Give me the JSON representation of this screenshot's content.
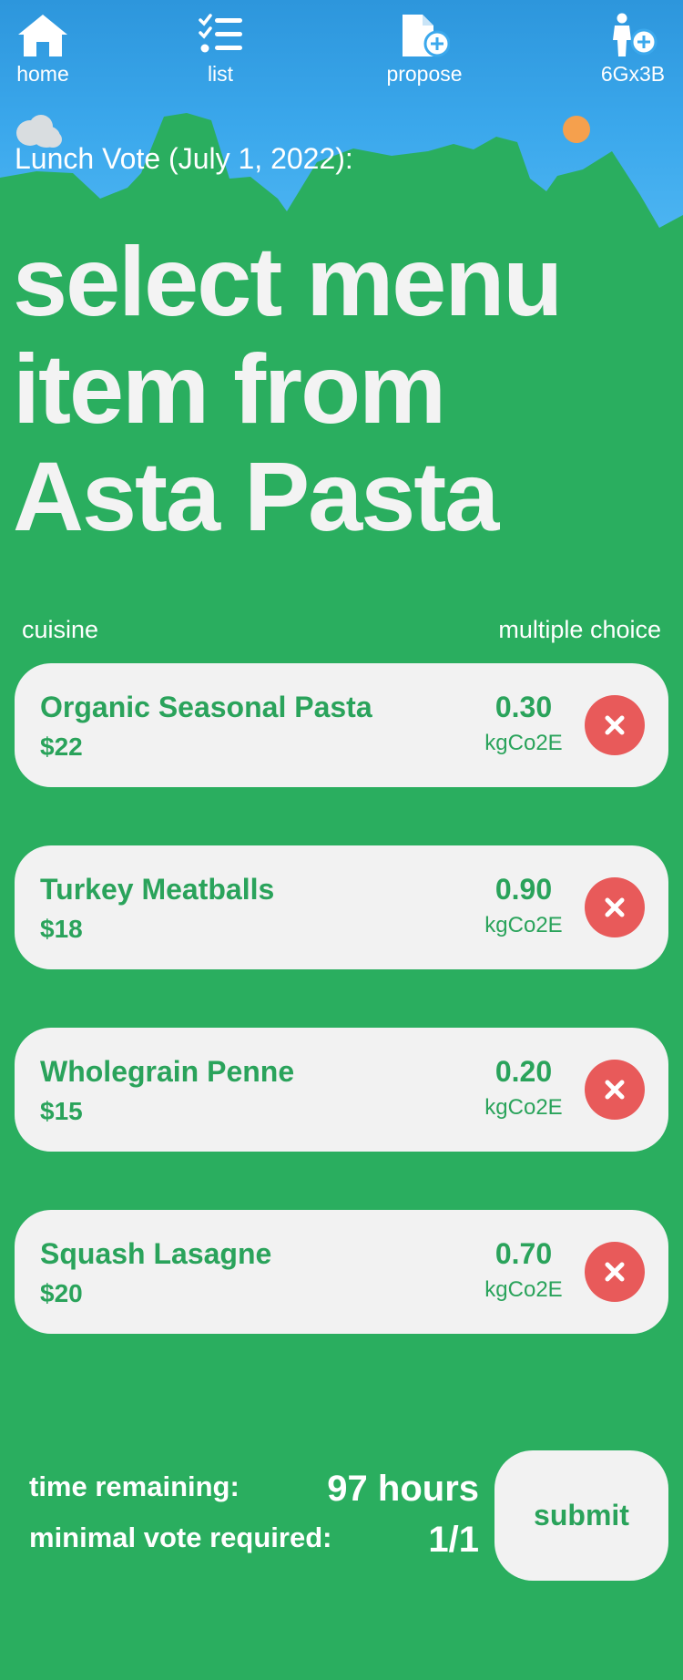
{
  "nav": {
    "home_label": "home",
    "list_label": "list",
    "propose_label": "propose",
    "user_label": "6Gx3B"
  },
  "vote_title": "Lunch Vote (July 1, 2022):",
  "headline": {
    "line1": "select menu",
    "line2": "item from",
    "line3": "Asta Pasta"
  },
  "list_header": {
    "left": "cuisine",
    "right": "multiple choice"
  },
  "menu_items": [
    {
      "name": "Organic Seasonal Pasta",
      "price": "$22",
      "co2": "0.30",
      "unit": "kgCo2E"
    },
    {
      "name": "Turkey Meatballs",
      "price": "$18",
      "co2": "0.90",
      "unit": "kgCo2E"
    },
    {
      "name": "Wholegrain Penne",
      "price": "$15",
      "co2": "0.20",
      "unit": "kgCo2E"
    },
    {
      "name": "Squash Lasagne",
      "price": "$20",
      "co2": "0.70",
      "unit": "kgCo2E"
    }
  ],
  "footer": {
    "time_label": "time remaining:",
    "time_value": "97 hours",
    "vote_label": "minimal vote required:",
    "vote_value": "1/1",
    "submit_label": "submit"
  },
  "icons": {
    "home": "home-icon",
    "list": "checklist-icon",
    "propose": "add-document-icon",
    "user": "add-person-icon",
    "remove": "close-icon"
  },
  "colors": {
    "background_green": "#2aae5f",
    "sky_blue": "#3ba8ec",
    "card_bg": "#f2f2f2",
    "text_green": "#2aa35b",
    "remove_red": "#e85a5a",
    "sun_orange": "#f5a04d"
  }
}
